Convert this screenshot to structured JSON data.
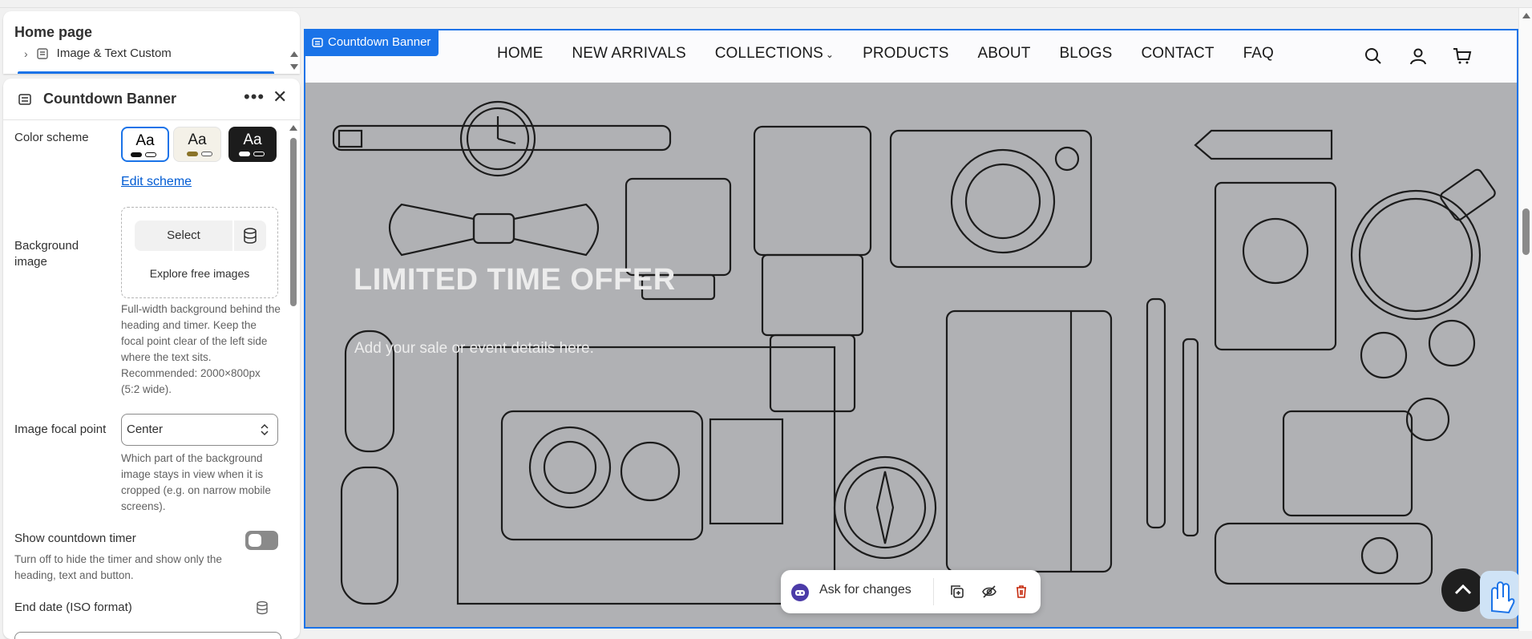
{
  "sidebar": {
    "page_title": "Home page",
    "tree_item": "Image & Text Custom",
    "panel_title": "Countdown Banner",
    "more_icon": "more-horizontal-icon",
    "close_icon": "close-icon",
    "color_scheme": {
      "label": "Color scheme",
      "swatches": [
        {
          "text": "Aa",
          "bg": "#ffffff",
          "fg": "#000000",
          "pill1": "#111111",
          "pill2": "#ffffff"
        },
        {
          "text": "Aa",
          "bg": "#f4f1e8",
          "fg": "#1a1a1a",
          "pill1": "#8a7328",
          "pill2": "#ffffff"
        },
        {
          "text": "Aa",
          "bg": "#1c1c1c",
          "fg": "#ffffff",
          "pill1": "#ffffff",
          "pill2": "#1c1c1c"
        }
      ],
      "edit_link": "Edit scheme"
    },
    "background_image": {
      "label": "Background image",
      "select_label": "Select",
      "explore_label": "Explore free images",
      "help": "Full-width background behind the heading and timer. Keep the focal point clear of the left side where the text sits. Recommended: 2000×800px (5:2 wide)."
    },
    "focal_point": {
      "label": "Image focal point",
      "value": "Center",
      "help": "Which part of the background image stays in view when it is cropped (e.g. on narrow mobile screens)."
    },
    "countdown": {
      "label": "Show countdown timer",
      "enabled": false,
      "help": "Turn off to hide the timer and show only the heading, text and button."
    },
    "end_date": {
      "label": "End date (ISO format)"
    }
  },
  "preview": {
    "badge": "Countdown Banner",
    "nav": [
      "HOME",
      "NEW ARRIVALS",
      "COLLECTIONS",
      "PRODUCTS",
      "ABOUT",
      "BLOGS",
      "CONTACT",
      "FAQ"
    ],
    "hero_title": "LIMITED TIME OFFER",
    "hero_sub": "Add your sale or event details here.",
    "ask_label": "Ask for changes"
  },
  "colors": {
    "accent": "#1a73e8",
    "hero_bg": "#b0b1b4"
  }
}
